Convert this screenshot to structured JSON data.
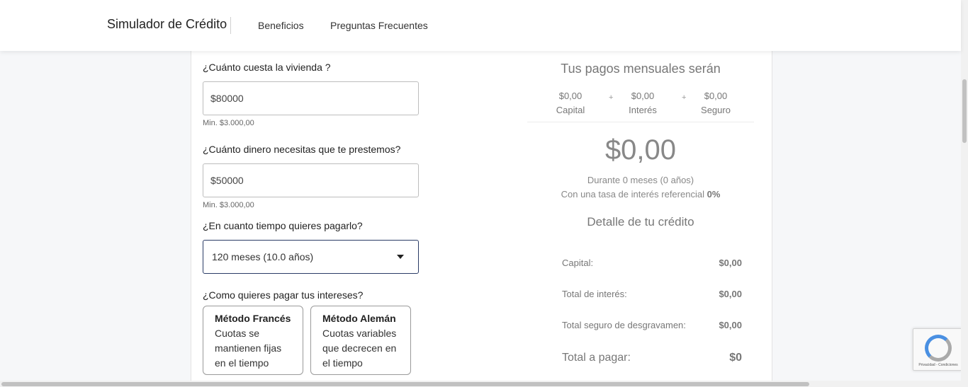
{
  "header": {
    "brand": "Simulador de Crédito",
    "nav": [
      "Beneficios",
      "Preguntas Frecuentes"
    ]
  },
  "form": {
    "price_label": "¿Cuánto cuesta la vivienda ?",
    "price_value": "$80000",
    "price_hint": "Min. $3.000,00",
    "loan_label": "¿Cuánto dinero necesitas que te prestemos?",
    "loan_value": "$50000",
    "loan_hint": "Min. $3.000,00",
    "term_label": "¿En cuanto tiempo quieres pagarlo?",
    "term_value": "120 meses (10.0 años)",
    "interest_label": "¿Como quieres pagar tus intereses?",
    "methods": [
      {
        "title": "Método Francés",
        "desc": "Cuotas se mantienen fijas en el tiempo"
      },
      {
        "title": "Método Alemán",
        "desc": "Cuotas variables que decrecen en el tiempo"
      }
    ]
  },
  "results": {
    "title": "Tus pagos mensuales serán",
    "breakdown": [
      {
        "amount": "$0,00",
        "label": "Capital"
      },
      {
        "amount": "$0,00",
        "label": "Interés"
      },
      {
        "amount": "$0,00",
        "label": "Seguro"
      }
    ],
    "plus": "+",
    "monthly_total": "$0,00",
    "duration_text": "Durante 0 meses (0 años)",
    "rate_text": "Con una tasa de interés referencial",
    "rate_value": "0%",
    "detail_title": "Detalle de tu crédito",
    "details": [
      {
        "label": "Capital:",
        "value": "$0,00"
      },
      {
        "label": "Total de interés:",
        "value": "$0,00"
      },
      {
        "label": "Total seguro de desgravamen:",
        "value": "$0,00"
      },
      {
        "label": "Total a pagar:",
        "value": "$0"
      }
    ]
  },
  "recaptcha": {
    "text": "Privacidad - Condiciones"
  },
  "colors": {
    "select_border": "#2a3b66",
    "recaptcha_blue": "#4a90e2"
  }
}
